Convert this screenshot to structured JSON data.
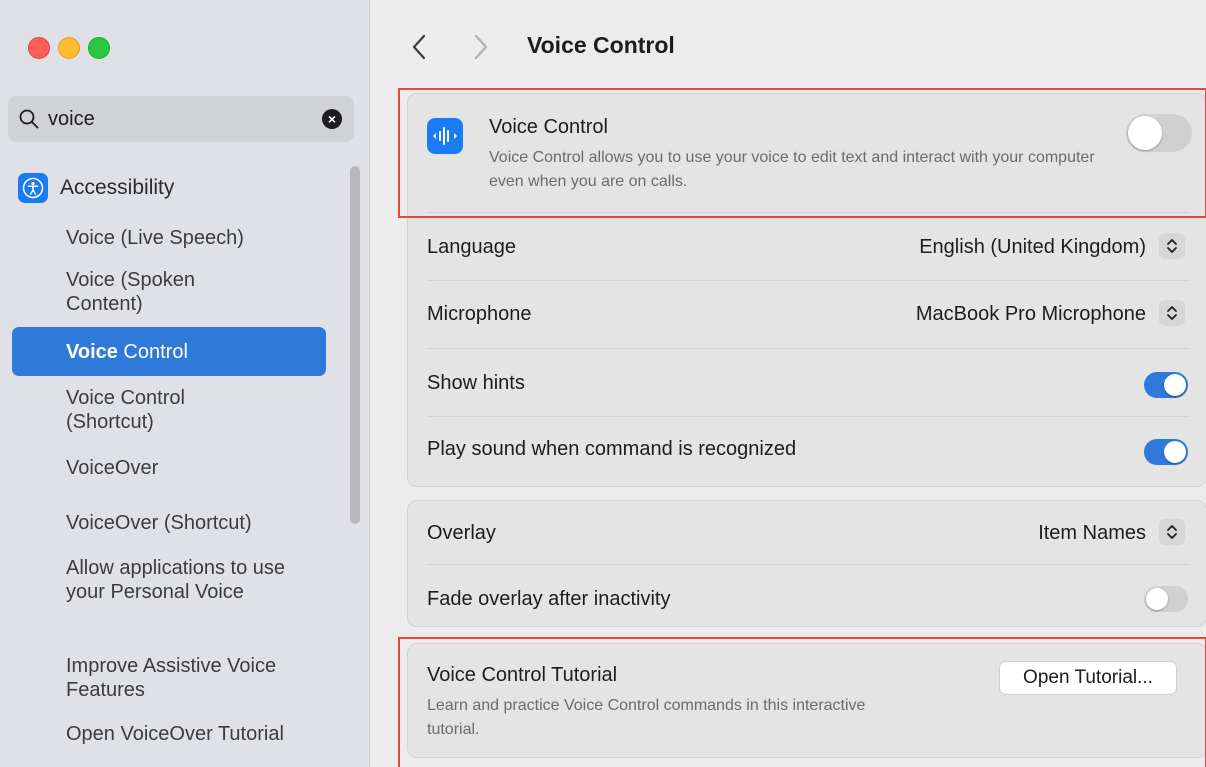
{
  "window": {
    "title": "Voice Control"
  },
  "sidebar": {
    "search": {
      "value": "voice",
      "placeholder": "Search"
    },
    "section": {
      "label": "Accessibility",
      "icon": "accessibility-icon"
    },
    "items": [
      {
        "label": "Voice (Live Speech)"
      },
      {
        "label": "Voice (Spoken Content)"
      },
      {
        "label_bold": "Voice",
        "label_rest": " Control",
        "selected": true
      },
      {
        "label": "Voice Control (Shortcut)"
      },
      {
        "label": "VoiceOver"
      },
      {
        "label": "VoiceOver (Shortcut)"
      },
      {
        "label": "Allow applications to use your Personal Voice"
      },
      {
        "label": "Improve Assistive Voice Features"
      },
      {
        "label": "Open VoiceOver Tutorial"
      }
    ]
  },
  "main": {
    "voice_control": {
      "title": "Voice Control",
      "description": "Voice Control allows you to use your voice to edit text and interact with your computer even when you are on calls.",
      "enabled": false,
      "icon": "waveform-icon"
    },
    "settings": [
      {
        "label": "Language",
        "value": "English (United Kingdom)"
      },
      {
        "label": "Microphone",
        "value": "MacBook Pro Microphone"
      },
      {
        "label": "Show hints",
        "enabled": true
      },
      {
        "label": "Play sound when command is recognized",
        "enabled": true
      }
    ],
    "overlay": {
      "label": "Overlay",
      "value": "Item Names",
      "fade_label": "Fade overlay after inactivity",
      "fade_enabled": false
    },
    "tutorial": {
      "title": "Voice Control Tutorial",
      "description": "Learn and practice Voice Control commands in this interactive tutorial.",
      "button": "Open Tutorial..."
    }
  },
  "colors": {
    "accent": "#2f7ad8",
    "highlight": "#e5493b",
    "close": "#fe5f57",
    "minimize": "#febc2e",
    "maximize": "#28c840"
  }
}
